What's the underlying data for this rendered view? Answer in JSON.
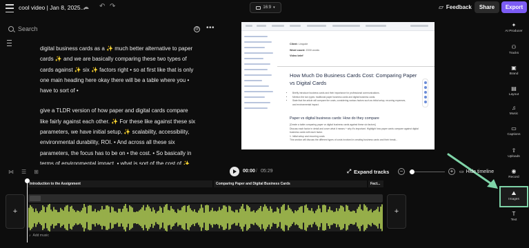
{
  "header": {
    "title": "cool video | Jan 8, 2025...",
    "aspect_ratio": "16:9",
    "feedback_label": "Feedback",
    "share_label": "Share",
    "export_label": "Export"
  },
  "script_panel": {
    "search_placeholder": "Search",
    "paragraphs": [
      "digital business cards as a ✨ much better alternative to paper cards ✨ and we are basically comparing these two types of cards against ✨ six ✨ factors right • so at first like that is only one main heading here okay there will be a table where you • have to sort of •",
      "give a TLDR version of how paper and digital cards compare like fairly against each other. ✨ For these like against these six parameters, we have initial setup, ✨ scalability, accessibility, environmental durability, ROI. • And across all these six parameters, the focus has to be on • the cost. • So basically in terms of environmental impact, • what is sort of the cost of ✨ using"
    ]
  },
  "preview_doc": {
    "meta": [
      {
        "key": "Client:",
        "value": "Linqode"
      },
      {
        "key": "Word count:",
        "value": "2000 words"
      },
      {
        "key": "Video brief",
        "value": ""
      }
    ],
    "heading": "How Much Do Business Cards Cost: Comparing Paper vs Digital Cards",
    "bullets": [
      "Briefly introduce business cards and their importance for professional communications.",
      "Mention the two types: traditional paper business cards and digital business cards.",
      "State that the article will compare the costs, considering various factors such as initial setup, recurring expenses, and environmental impact."
    ],
    "subheading": "Paper vs digital business cards: How do they compare",
    "body": [
      "[Create a table comparing paper vs digital business cards against these six factors]",
      "Discuss each factor in detail and cover what it means + why it's important. Highlight how paper cards compare against digital business cards with each factor.",
      "1. Initial setup and recurring costs",
      "This section will discuss the different types of costs involved in creating business cards and their break..."
    ]
  },
  "sidebar": {
    "items": [
      {
        "label": "AI Producer",
        "icon": "sparkle-icon"
      },
      {
        "label": "Tracks",
        "icon": "tracks-icon"
      },
      {
        "label": "Brand",
        "icon": "brand-icon"
      },
      {
        "label": "Layout",
        "icon": "layout-icon"
      },
      {
        "label": "Music",
        "icon": "music-icon"
      },
      {
        "label": "Captions",
        "icon": "captions-icon"
      },
      {
        "label": "Uploads",
        "icon": "upload-icon"
      },
      {
        "label": "Record",
        "icon": "record-icon"
      },
      {
        "label": "Images",
        "icon": "images-icon"
      },
      {
        "label": "Text",
        "icon": "text-icon"
      }
    ],
    "active_item": "Images",
    "highlight_color": "#7fd4a8"
  },
  "timeline": {
    "current_time": "00:00",
    "separator": "/",
    "total_time": "05:29",
    "expand_label": "Expand tracks",
    "hide_label": "Hide timeline",
    "zoom_level": 0.05,
    "chapters": [
      "Introduction to the Assignment",
      "Comparing Paper and Digital Business Cards",
      "Fact..."
    ],
    "add_music_label": "Add music",
    "waveform_color": "#c9ec5c",
    "accent_color": "#7c5cf5"
  }
}
